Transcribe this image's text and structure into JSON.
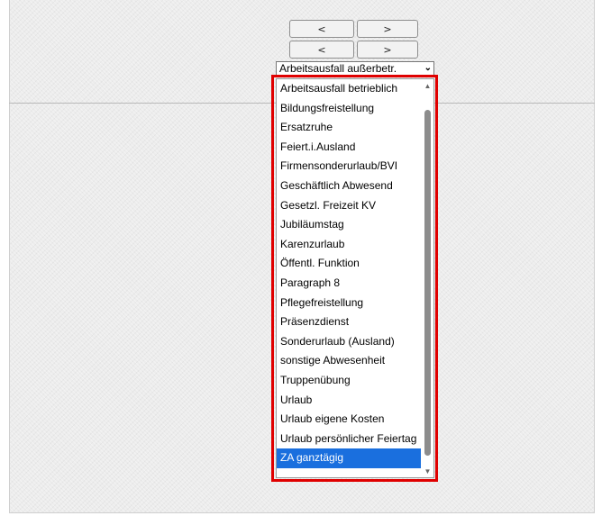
{
  "nav": {
    "prev_label": "<",
    "next_label": ">"
  },
  "select": {
    "value": "Arbeitsausfall außerbetr."
  },
  "dropdown": {
    "options": [
      "Arbeitsausfall betrieblich",
      "Bildungsfreistellung",
      "Ersatzruhe",
      "Feiert.i.Ausland",
      "Firmensonderurlaub/BVI",
      "Geschäftlich Abwesend",
      "Gesetzl. Freizeit KV",
      "Jubiläumstag",
      "Karenzurlaub",
      "Öffentl. Funktion",
      "Paragraph 8",
      "Pflegefreistellung",
      "Präsenzdienst",
      "Sonderurlaub (Ausland)",
      "sonstige Abwesenheit",
      "Truppenübung",
      "Urlaub",
      "Urlaub eigene Kosten",
      "Urlaub persönlicher Feiertag",
      "ZA ganztägig"
    ],
    "selected": "ZA ganztägig"
  },
  "icons": {
    "scroll_up": "triangle-up-icon",
    "scroll_down": "triangle-down-icon",
    "select_arrow": "chevron-down-icon"
  },
  "colors": {
    "selection": "#1a6fde",
    "highlight_border": "#e00000"
  }
}
